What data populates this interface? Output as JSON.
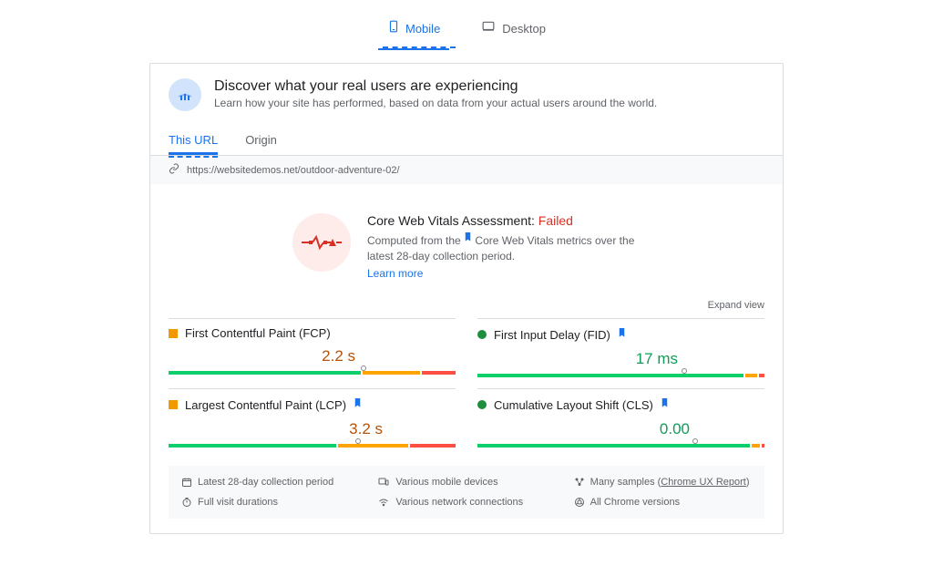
{
  "topTabs": {
    "mobile": "Mobile",
    "desktop": "Desktop"
  },
  "header": {
    "title": "Discover what your real users are experiencing",
    "subtitle": "Learn how your site has performed, based on data from your actual users around the world."
  },
  "urlTabs": {
    "thisUrl": "This URL",
    "origin": "Origin"
  },
  "url": "https://websitedemos.net/outdoor-adventure-02/",
  "assessment": {
    "titlePrefix": "Core Web Vitals Assessment: ",
    "status": "Failed",
    "descPrefix": "Computed from the ",
    "descSuffix": " Core Web Vitals metrics over the latest 28-day collection period.",
    "learnMore": "Learn more"
  },
  "expandView": "Expand view",
  "metrics": {
    "fcp": {
      "name": "First Contentful Paint (FCP)",
      "value": "2.2 s",
      "status": "orange"
    },
    "fid": {
      "name": "First Input Delay (FID)",
      "value": "17 ms",
      "status": "green"
    },
    "lcp": {
      "name": "Largest Contentful Paint (LCP)",
      "value": "3.2 s",
      "status": "orange"
    },
    "cls": {
      "name": "Cumulative Layout Shift (CLS)",
      "value": "0.00",
      "status": "green"
    }
  },
  "footer": {
    "period": "Latest 28-day collection period",
    "devices": "Various mobile devices",
    "samplesPrefix": "Many samples (",
    "samplesLink": "Chrome UX Report",
    "samplesSuffix": ")",
    "durations": "Full visit durations",
    "connections": "Various network connections",
    "versions": "All Chrome versions"
  }
}
